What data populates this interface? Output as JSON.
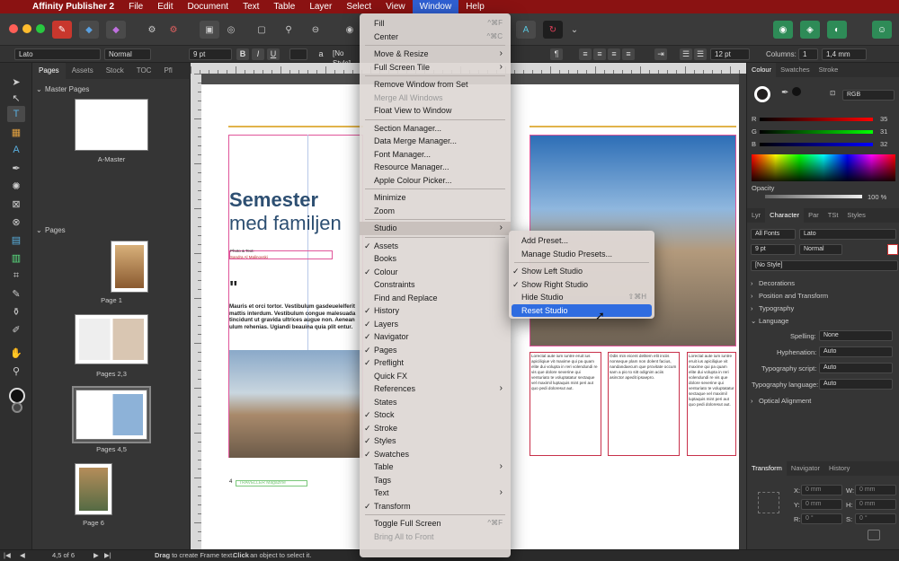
{
  "menubar": {
    "apple_icon": "apple-icon",
    "items": [
      "Affinity Publisher 2",
      "File",
      "Edit",
      "Document",
      "Text",
      "Table",
      "Layer",
      "Select",
      "View",
      "Window",
      "Help"
    ],
    "active": "Window"
  },
  "context": {
    "font": "Lato",
    "style": "Normal",
    "size": "9 pt",
    "bold": "B",
    "italic": "I",
    "underline": "U",
    "char_style": "[No Style]",
    "leading": "12 pt",
    "columns_label": "Columns:",
    "columns_value": "1",
    "gutter": "1,4 mm"
  },
  "pages_panel": {
    "tabs": [
      "Pages",
      "Assets",
      "Stock",
      "TOC",
      "Pfl"
    ],
    "master_header": "Master Pages",
    "master_name": "A-Master",
    "pages_header": "Pages",
    "thumbs": [
      "Page 1",
      "Pages 2,3",
      "Pages 4,5",
      "Page 6"
    ]
  },
  "document": {
    "title_line1": "Semester",
    "title_line2": "med familjen",
    "photo_credit1": "Photo & Text:",
    "photo_credit2": "Sandra Al Malinovski",
    "quote_mark": "\"",
    "lead_text": "Mauris et orci tortor. Vestibulum gasdeuelelferit mattis interdum. Vestibulum congue malesuada tincidunt ut gravida ultrices augue non. Aenean ulum rehenias. Ugiandi beauina quia plit entur.",
    "folio": "4",
    "folio_label": "TRAVELLER Magazine",
    "col1_text": "Lorectal aute ium iuntre eruit ius apiciliqiue vit maxime qui pa quam elite dui volupta in reri volendundi re vis que dolore severine qui venturiato te voluptatatur sectaque vel maximil luptaquis mint peri aut quo pedi doloresut aut.",
    "col2_text": "Odis min eicent delitem elit inciis nonseque plam non dolent facius, nandandaecum que provitate occum sam a pio to sitt odignim aciis asinctor apedit ipsaepro."
  },
  "window_menu": {
    "items": [
      {
        "label": "Fill",
        "shortcut": "^⌘F"
      },
      {
        "label": "Center",
        "shortcut": "^⌘C"
      },
      {
        "sep": true
      },
      {
        "label": "Move & Resize",
        "arrow": true
      },
      {
        "label": "Full Screen Tile",
        "arrow": true
      },
      {
        "sep": true
      },
      {
        "label": "Remove Window from Set"
      },
      {
        "label": "Merge All Windows",
        "disabled": true
      },
      {
        "label": "Float View to Window"
      },
      {
        "sep": true
      },
      {
        "label": "Section Manager..."
      },
      {
        "label": "Data Merge Manager..."
      },
      {
        "label": "Font Manager..."
      },
      {
        "label": "Resource Manager..."
      },
      {
        "label": "Apple Colour Picker..."
      },
      {
        "sep": true
      },
      {
        "label": "Minimize"
      },
      {
        "label": "Zoom"
      },
      {
        "sep": true
      },
      {
        "label": "Studio",
        "arrow": true,
        "highlighted": true
      },
      {
        "sep": true
      },
      {
        "label": "Assets",
        "checked": true
      },
      {
        "label": "Books"
      },
      {
        "label": "Colour",
        "checked": true
      },
      {
        "label": "Constraints"
      },
      {
        "label": "Find and Replace"
      },
      {
        "label": "History",
        "checked": true
      },
      {
        "label": "Layers",
        "checked": true
      },
      {
        "label": "Navigator",
        "checked": true
      },
      {
        "label": "Pages",
        "checked": true
      },
      {
        "label": "Preflight",
        "checked": true
      },
      {
        "label": "Quick FX"
      },
      {
        "label": "References",
        "arrow": true
      },
      {
        "label": "States"
      },
      {
        "label": "Stock",
        "checked": true
      },
      {
        "label": "Stroke",
        "checked": true
      },
      {
        "label": "Styles",
        "checked": true
      },
      {
        "label": "Swatches",
        "checked": true
      },
      {
        "label": "Table",
        "arrow": true
      },
      {
        "label": "Tags"
      },
      {
        "label": "Text",
        "arrow": true
      },
      {
        "label": "Transform",
        "checked": true
      },
      {
        "sep": true
      },
      {
        "label": "Toggle Full Screen",
        "shortcut": "^⌘F"
      },
      {
        "label": "Bring All to Front",
        "disabled": true
      }
    ]
  },
  "studio_submenu": {
    "items": [
      {
        "label": "Add Preset..."
      },
      {
        "label": "Manage Studio Presets..."
      },
      {
        "sep": true
      },
      {
        "label": "Show Left Studio",
        "checked": true
      },
      {
        "label": "Show Right Studio",
        "checked": true
      },
      {
        "label": "Hide Studio",
        "shortcut": "⇧⌘H"
      },
      {
        "label": "Reset Studio",
        "selected": true
      }
    ]
  },
  "right_panel": {
    "tabs1": [
      "Colour",
      "Swatches",
      "Stroke"
    ],
    "colour_mode": "RGB",
    "r_label": "R",
    "r_value": "35",
    "g_label": "G",
    "g_value": "31",
    "b_label": "B",
    "b_value": "32",
    "opacity_label": "Opacity",
    "opacity_value": "100 %",
    "tabs2": [
      "Lyr",
      "Character",
      "Par",
      "TSt",
      "Styles"
    ],
    "all_fonts": "All Fonts",
    "font": "Lato",
    "size": "9 pt",
    "weight": "Normal",
    "no_style": "[No Style]",
    "sections": [
      "Decorations",
      "Position and Transform",
      "Typography",
      "Language"
    ],
    "spelling_label": "Spelling:",
    "spelling_value": "None",
    "hyphenation_label": "Hyphenation:",
    "hyphenation_value": "Auto",
    "typo_script_label": "Typography script:",
    "typo_script_value": "Auto",
    "typo_lang_label": "Typography language:",
    "typo_lang_value": "Auto",
    "optical": "Optical Alignment",
    "tabs3": [
      "Transform",
      "Navigator",
      "History"
    ],
    "x_label": "X:",
    "x_value": "0 mm",
    "y_label": "Y:",
    "y_value": "0 mm",
    "w_label": "W:",
    "w_value": "0 mm",
    "h_label": "H:",
    "h_value": "0 mm",
    "r_rot_label": "R:",
    "r_rot_value": "0 °",
    "s_label": "S:",
    "s_value": "0 °"
  },
  "status": {
    "page_indicator": "4,5 of 6",
    "drag": "Drag",
    "hint1": " to create Frame text. ",
    "click": "Click",
    "hint2": " an object to select it."
  },
  "colors": {
    "menubar": "#8a1212",
    "accent_blue": "#2f6ce0",
    "title_blue": "#2d4f72",
    "frame_pink": "#e0559a",
    "gold_line": "#e1b34a"
  }
}
